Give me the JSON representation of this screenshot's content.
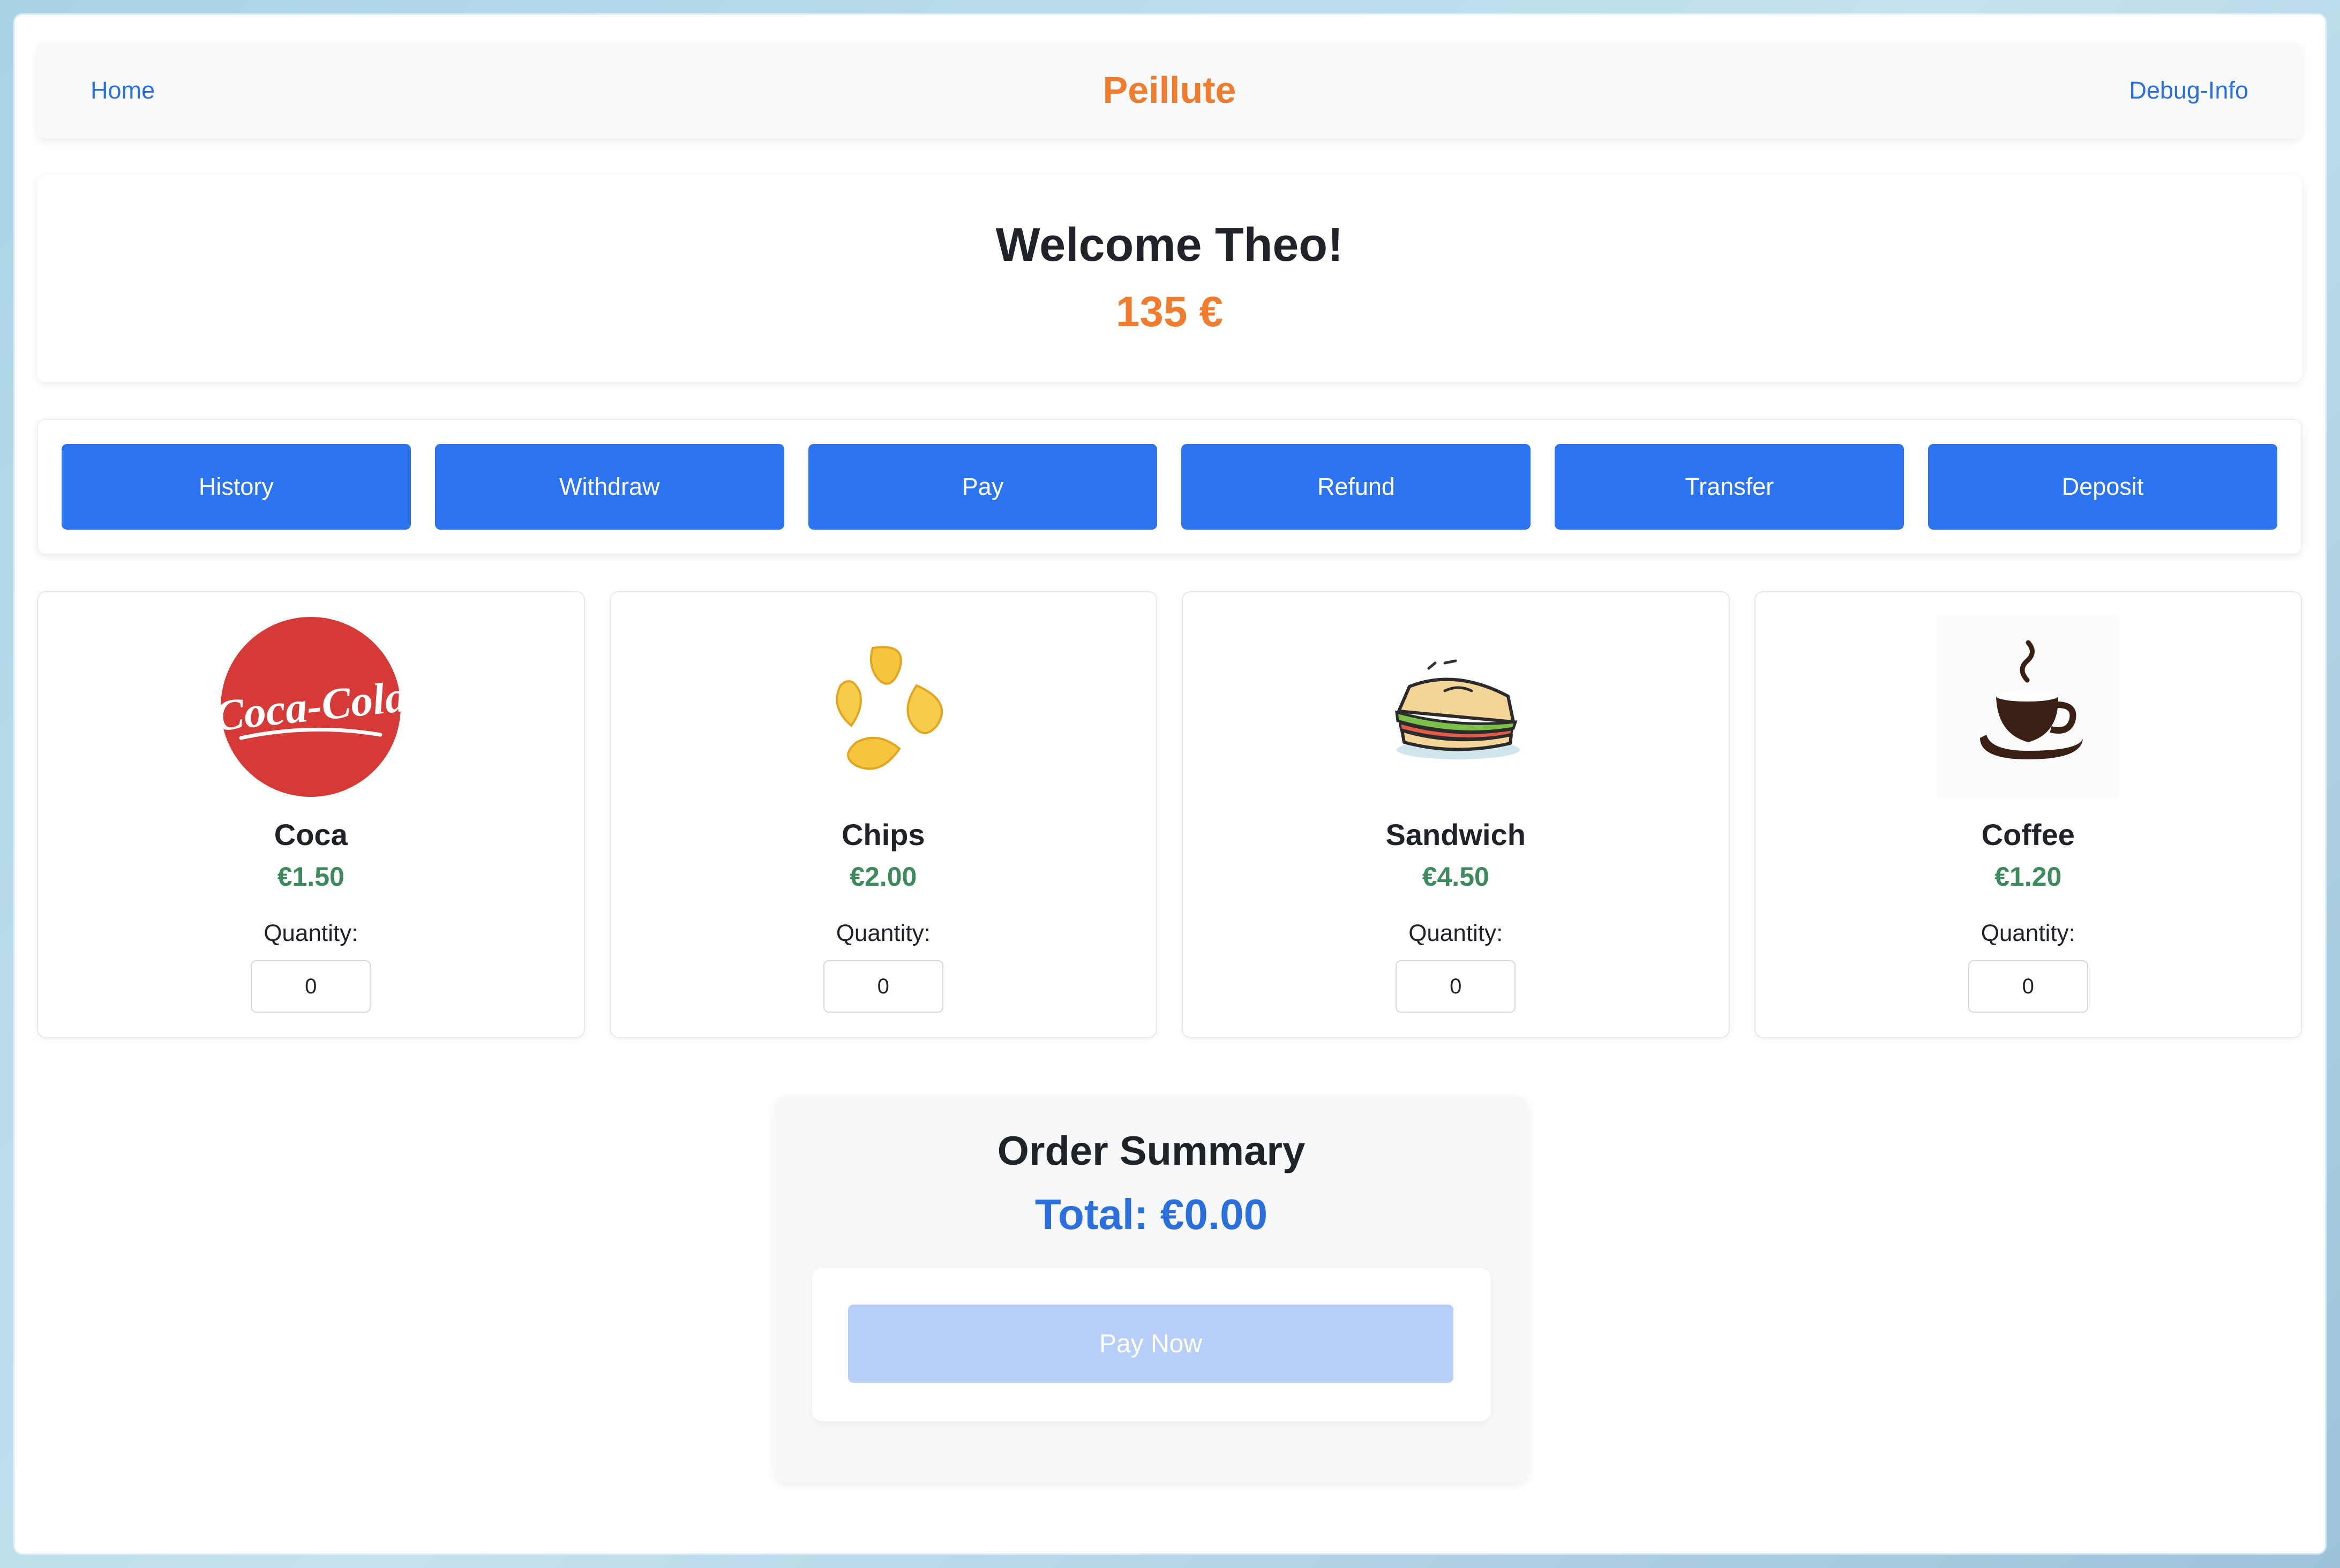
{
  "navbar": {
    "home_label": "Home",
    "brand": "Peillute",
    "debug_label": "Debug-Info",
    "brand_color": "#ef7d2d",
    "link_color": "#2a6fdb"
  },
  "welcome": {
    "title": "Welcome Theo!",
    "balance": "135 €"
  },
  "actions": [
    {
      "label": "History"
    },
    {
      "label": "Withdraw"
    },
    {
      "label": "Pay"
    },
    {
      "label": "Refund"
    },
    {
      "label": "Transfer"
    },
    {
      "label": "Deposit"
    }
  ],
  "products": [
    {
      "name": "Coca",
      "price": "€1.50",
      "quantity_label": "Quantity:",
      "quantity": "0",
      "icon": "coca-cola-logo",
      "logo_text": "Coca-Cola"
    },
    {
      "name": "Chips",
      "price": "€2.00",
      "quantity_label": "Quantity:",
      "quantity": "0",
      "icon": "chips-icon"
    },
    {
      "name": "Sandwich",
      "price": "€4.50",
      "quantity_label": "Quantity:",
      "quantity": "0",
      "icon": "sandwich-icon"
    },
    {
      "name": "Coffee",
      "price": "€1.20",
      "quantity_label": "Quantity:",
      "quantity": "0",
      "icon": "coffee-cup-icon"
    }
  ],
  "summary": {
    "title": "Order Summary",
    "total": "Total: €0.00",
    "pay_label": "Pay Now"
  },
  "colors": {
    "primary_button": "#2c73f0",
    "price_green": "#3d8b5c",
    "disabled_button": "#b7cff8"
  }
}
